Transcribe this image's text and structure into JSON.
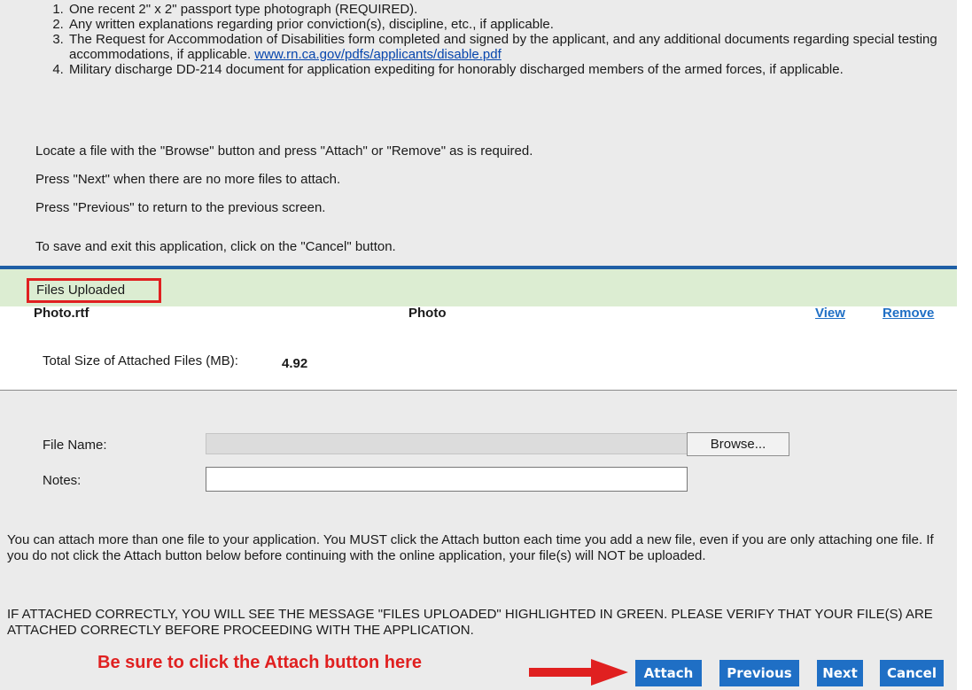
{
  "requirements": [
    {
      "text": "One recent 2\" x 2\" passport type photograph (REQUIRED)."
    },
    {
      "text": "Any written explanations regarding prior conviction(s), discipline, etc., if applicable."
    },
    {
      "text": "The Request for Accommodation of Disabilities form completed and signed by the applicant, and any additional documents regarding special testing accommodations, if applicable.",
      "link": "www.rn.ca.gov/pdfs/applicants/disable.pdf"
    },
    {
      "text": "Military discharge DD-214 document for application expediting for honorably discharged members of the armed forces, if applicable."
    }
  ],
  "instructions": {
    "locate": "Locate a file with the \"Browse\" button and press \"Attach\" or \"Remove\" as is required.",
    "next": "Press \"Next\" when there are no more files to attach.",
    "previous": "Press \"Previous\" to return to the previous screen.",
    "cancel": "To save and exit this application, click on the \"Cancel\" button."
  },
  "uploaded": {
    "heading": "Files Uploaded",
    "file_name": "Photo.rtf",
    "file_type": "Photo",
    "view_label": "View",
    "remove_label": "Remove",
    "total_label": "Total Size of Attached Files (MB):",
    "total_value": "4.92"
  },
  "form": {
    "file_name_label": "File Name:",
    "browse_label": "Browse...",
    "notes_label": "Notes:",
    "notes_value": ""
  },
  "notices": {
    "multi_file": "You can attach more than one file to your application. You MUST click the Attach button each time you add a new file, even if you are only attaching one file. If you do not click the Attach button below before continuing with the online application, your file(s) will NOT be uploaded.",
    "verify": "IF ATTACHED CORRECTLY, YOU WILL SEE THE MESSAGE \"FILES UPLOADED\" HIGHLIGHTED IN GREEN. PLEASE VERIFY THAT YOUR FILE(S) ARE ATTACHED CORRECTLY BEFORE PROCEEDING WITH THE APPLICATION."
  },
  "annotation": {
    "text": "Be sure to click the Attach button here",
    "color": "#e02020"
  },
  "buttons": {
    "attach": "Attach",
    "previous": "Previous",
    "next": "Next",
    "cancel": "Cancel"
  },
  "colors": {
    "button_blue": "#1f6fc5",
    "uploaded_green": "#dcedd2",
    "highlight_red": "#e02020",
    "panel_gray": "#ebebeb"
  }
}
